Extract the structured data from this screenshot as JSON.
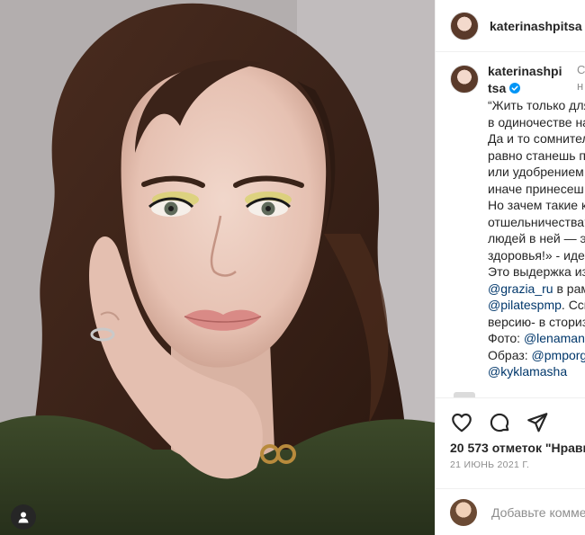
{
  "post": {
    "username": "katerinashpitsa",
    "photo_alt": "Portrait photo"
  },
  "caption": {
    "username_line1": "katerinashpi",
    "username_line2": "tsa",
    "follow_fragment_1": "С",
    "follow_fragment_2": "н",
    "lines": [
      "“Жить только для",
      "в одиночестве на",
      "Да и то сомнител",
      "равно станешь п",
      "или удобрением",
      "иначе принесеш",
      "Но зачем такие к",
      "отшельничества?",
      "людей в ней — э",
      "здоровья!» - иде",
      "Это выдержка из"
    ],
    "line_mention_1": {
      "mention": "@grazia_ru",
      "text": " в рам"
    },
    "line_mention_2": {
      "mention": "@pilatespmp",
      "text": ". Ссы"
    },
    "line_plain_2": "версию- в сториз",
    "line_photo": {
      "label": "Фото: ",
      "mention": "@lenamana"
    },
    "line_look": {
      "label": "Образ: ",
      "mention": "@pmporg"
    },
    "line_last_mention": "@kyklamasha"
  },
  "actions": {
    "like_icon": "heart-icon",
    "comment_icon": "comment-icon",
    "share_icon": "share-icon"
  },
  "likes_text": "20 573 отметок \"Нрави",
  "date_text": "21 ИЮНЬ 2021 Г.",
  "comment": {
    "placeholder": "Добавьте комме"
  },
  "colors": {
    "verified": "#0095f6",
    "mention": "#00376b",
    "muted": "#8e8e8e",
    "text": "#262626"
  }
}
